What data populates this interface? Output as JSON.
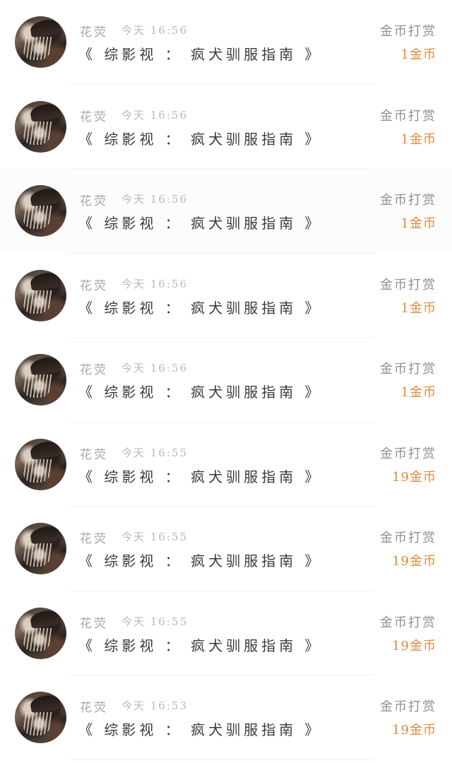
{
  "items": [
    {
      "name": "花荧",
      "time": "今天 16:56",
      "title": "《 综影视 ： 疯犬驯服指南 》",
      "label": "金币打赏",
      "amount": "1金币"
    },
    {
      "name": "花荧",
      "time": "今天 16:56",
      "title": "《 综影视 ： 疯犬驯服指南 》",
      "label": "金币打赏",
      "amount": "1金币"
    },
    {
      "name": "花荧",
      "time": "今天 16:56",
      "title": "《 综影视 ： 疯犬驯服指南 》",
      "label": "金币打赏",
      "amount": "1金币"
    },
    {
      "name": "花荧",
      "time": "今天 16:56",
      "title": "《 综影视 ： 疯犬驯服指南 》",
      "label": "金币打赏",
      "amount": "1金币"
    },
    {
      "name": "花荧",
      "time": "今天 16:56",
      "title": "《 综影视 ： 疯犬驯服指南 》",
      "label": "金币打赏",
      "amount": "1金币"
    },
    {
      "name": "花荧",
      "time": "今天 16:55",
      "title": "《 综影视 ： 疯犬驯服指南 》",
      "label": "金币打赏",
      "amount": "19金币"
    },
    {
      "name": "花荧",
      "time": "今天 16:55",
      "title": "《 综影视 ： 疯犬驯服指南 》",
      "label": "金币打赏",
      "amount": "19金币"
    },
    {
      "name": "花荧",
      "time": "今天 16:55",
      "title": "《 综影视 ： 疯犬驯服指南 》",
      "label": "金币打赏",
      "amount": "19金币"
    },
    {
      "name": "花荧",
      "time": "今天 16:53",
      "title": "《 综影视 ： 疯犬驯服指南 》",
      "label": "金币打赏",
      "amount": "19金币"
    }
  ],
  "colors": {
    "amount": "#e08a3c",
    "name": "#a6a6a6",
    "title": "#3a3a3a"
  }
}
